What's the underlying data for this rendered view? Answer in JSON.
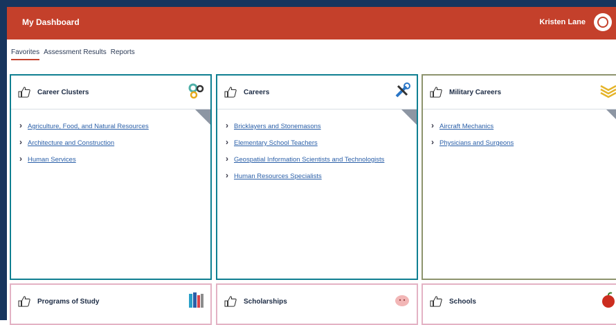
{
  "header": {
    "title": "My Dashboard",
    "user_name": "Kristen Lane"
  },
  "tabs": [
    {
      "label": "Favorites",
      "active": true
    },
    {
      "label": "Assessment Results",
      "active": false
    },
    {
      "label": "Reports",
      "active": false
    }
  ],
  "cards": [
    {
      "title": "Career Clusters",
      "icon": "gears-icon",
      "color": "#0f7f91",
      "links": [
        "Agriculture, Food, and Natural Resources",
        "Architecture and Construction",
        "Human Services"
      ]
    },
    {
      "title": "Careers",
      "icon": "wrench-icon",
      "color": "#0f7f91",
      "links": [
        "Bricklayers and Stonemasons",
        "Elementary School Teachers",
        "Geospatial Information Scientists and Technologists",
        "Human Resources Specialists"
      ]
    },
    {
      "title": "Military Careers",
      "icon": "chevrons-icon",
      "color": "#8d936d",
      "links": [
        "Aircraft Mechanics",
        "Physicians and Surgeons"
      ]
    },
    {
      "title": "Programs of Study",
      "icon": "books-icon",
      "color": "#e3b2c4",
      "links": []
    },
    {
      "title": "Scholarships",
      "icon": "piggy-bank-icon",
      "color": "#e3b2c4",
      "links": []
    },
    {
      "title": "Schools",
      "icon": "apple-icon",
      "color": "#e3b2c4",
      "links": []
    }
  ]
}
